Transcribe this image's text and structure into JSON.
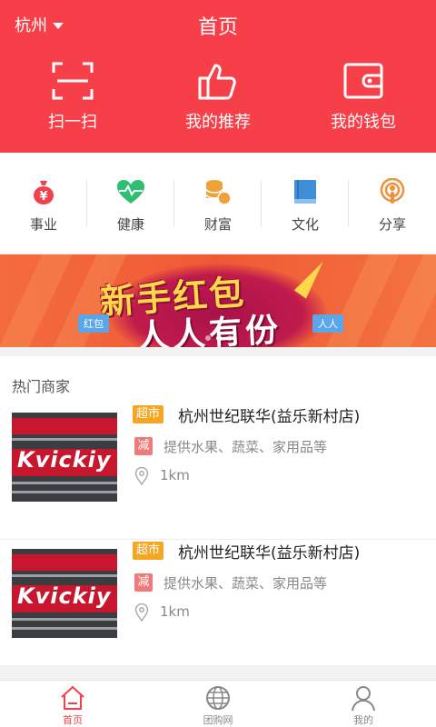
{
  "header": {
    "city": "杭州",
    "title": "首页",
    "background": "#f73f49",
    "actions": [
      {
        "label": "扫一扫",
        "icon": "scan-icon"
      },
      {
        "label": "我的推荐",
        "icon": "thumbs-up-icon"
      },
      {
        "label": "我的钱包",
        "icon": "wallet-icon"
      }
    ]
  },
  "categories": [
    {
      "label": "事业",
      "icon": "money-bag-icon",
      "color": "#f0414e"
    },
    {
      "label": "健康",
      "icon": "heart-pulse-icon",
      "color": "#2fbf73"
    },
    {
      "label": "财富",
      "icon": "coins-icon",
      "color": "#f0a23a"
    },
    {
      "label": "文化",
      "icon": "book-icon",
      "color": "#3e8fd8"
    },
    {
      "label": "分享",
      "icon": "podcast-icon",
      "color": "#f0903a"
    }
  ],
  "banner": {
    "line1": "新手红包",
    "line2": "人人有份",
    "flag_left": "红包",
    "flag_right": "人人",
    "slide_count": 3,
    "active_slide": 1
  },
  "shops": {
    "title": "热门商家",
    "items": [
      {
        "tag": "超市",
        "name": "杭州世纪联华(益乐新村店)",
        "promo_tag": "减",
        "desc": "提供水果、蔬菜、家用品等",
        "distance": "1km",
        "logo_text": "Kvickiy"
      },
      {
        "tag": "超市",
        "name": "杭州世纪联华(益乐新村店)",
        "promo_tag": "减",
        "desc": "提供水果、蔬菜、家用品等",
        "distance": "1km",
        "logo_text": "Kvickiy"
      }
    ]
  },
  "tabbar": {
    "active_color": "#f73f49",
    "tabs": [
      {
        "label": "首页",
        "icon": "home-icon",
        "active": true
      },
      {
        "label": "团购网",
        "icon": "globe-icon",
        "active": false
      },
      {
        "label": "我的",
        "icon": "user-icon",
        "active": false
      }
    ]
  }
}
